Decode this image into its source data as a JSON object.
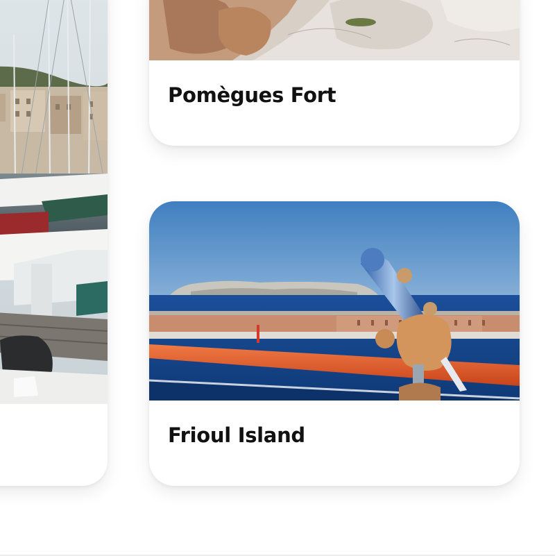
{
  "cards": [
    {
      "title": "",
      "image": "harbor-marina-photo"
    },
    {
      "title": "Pomègues Fort",
      "image": "rocky-coast-photo"
    },
    {
      "title": "Frioul Island",
      "image": "sea-telescope-photo"
    }
  ],
  "colors": {
    "background": "#ffffff",
    "card": "#ffffff",
    "title": "#111111"
  }
}
